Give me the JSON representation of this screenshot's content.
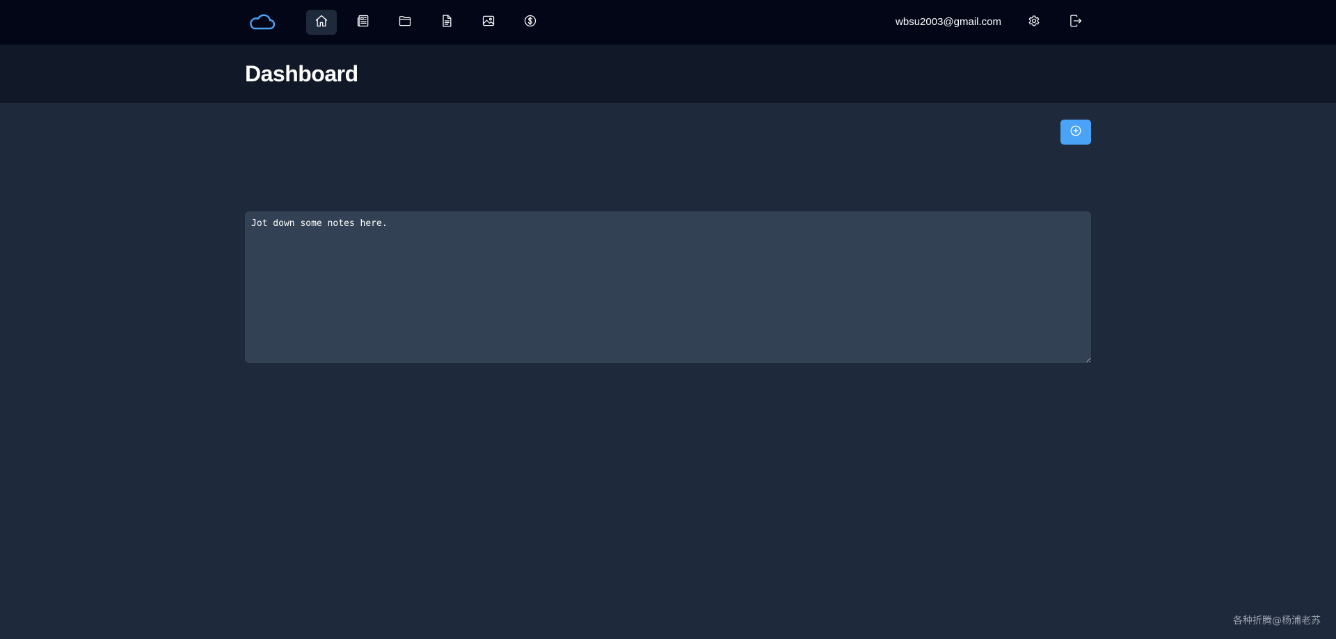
{
  "nav": {
    "logo_icon": "cloud-icon",
    "items": [
      {
        "icon": "home-icon",
        "active": true
      },
      {
        "icon": "newspaper-icon",
        "active": false
      },
      {
        "icon": "folder-icon",
        "active": false
      },
      {
        "icon": "document-icon",
        "active": false
      },
      {
        "icon": "image-icon",
        "active": false
      },
      {
        "icon": "dollar-icon",
        "active": false
      }
    ],
    "user_email": "wbsu2003@gmail.com",
    "settings_icon": "gear-icon",
    "logout_icon": "logout-icon"
  },
  "header": {
    "title": "Dashboard"
  },
  "toolbar": {
    "add_icon": "plus-circle-icon"
  },
  "notes": {
    "placeholder": "Jot down some notes here."
  },
  "watermark": "各种折腾@杨浦老苏",
  "colors": {
    "topbar_bg": "#030617",
    "header_bg": "#111827",
    "page_bg": "#1e293b",
    "textarea_bg": "#334155",
    "accent": "#4aa3f7"
  }
}
